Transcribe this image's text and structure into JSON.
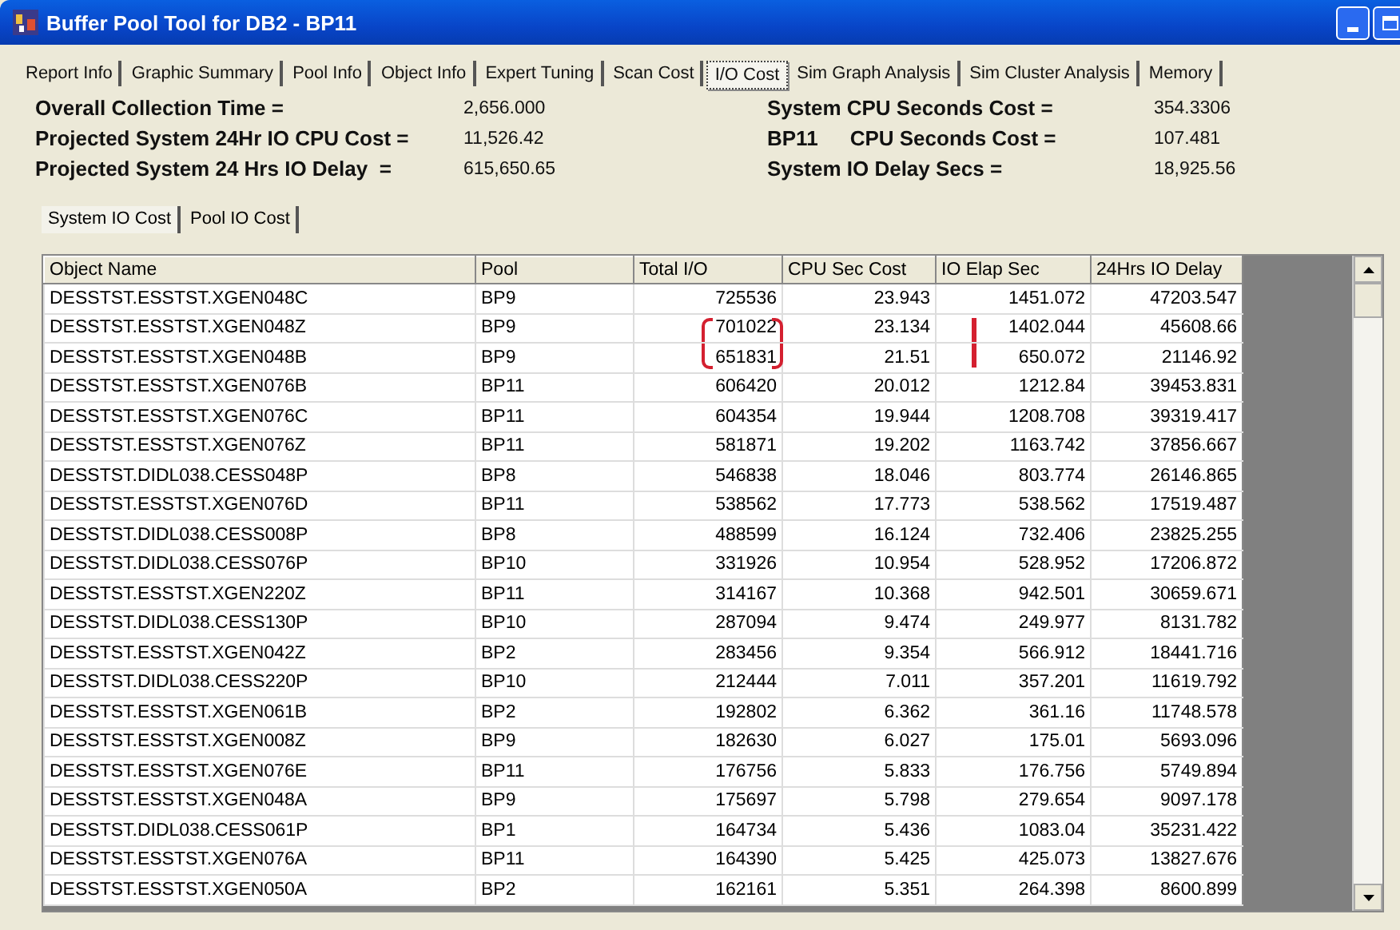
{
  "window": {
    "title": "Buffer Pool Tool for DB2 - BP11"
  },
  "tabs": [
    {
      "label": "Report Info",
      "selected": false
    },
    {
      "label": "Graphic Summary",
      "selected": false
    },
    {
      "label": "Pool Info",
      "selected": false
    },
    {
      "label": "Object Info",
      "selected": false
    },
    {
      "label": "Expert Tuning",
      "selected": false
    },
    {
      "label": "Scan Cost",
      "selected": false
    },
    {
      "label": "I/O Cost",
      "selected": true
    },
    {
      "label": "Sim Graph Analysis",
      "selected": false
    },
    {
      "label": "Sim Cluster Analysis",
      "selected": false
    },
    {
      "label": "Memory",
      "selected": false
    }
  ],
  "stats_left": [
    {
      "label": "Overall Collection Time =",
      "value": "2,656.000"
    },
    {
      "label": "Projected System 24Hr IO CPU Cost =",
      "value": "11,526.42"
    },
    {
      "label": "Projected System 24 Hrs IO Delay  =",
      "value": "615,650.65"
    }
  ],
  "stats_right": [
    {
      "label": "System CPU Seconds Cost =",
      "value": "354.3306"
    },
    {
      "prefix": "BP11",
      "label": "CPU Seconds Cost =",
      "value": "107.481"
    },
    {
      "label": "System IO Delay Secs =",
      "value": "18,925.56"
    }
  ],
  "sub_tabs": [
    {
      "label": "System IO Cost",
      "selected": true
    },
    {
      "label": "Pool IO Cost",
      "selected": false
    }
  ],
  "table": {
    "columns": [
      "Object Name",
      "Pool",
      "Total I/O",
      "CPU Sec Cost",
      "IO Elap Sec",
      "24Hrs IO Delay"
    ],
    "rows": [
      {
        "cells": [
          "DESSTST.ESSTST.XGEN048C",
          "BP9",
          "725536",
          "23.943",
          "1451.072",
          "47203.547"
        ],
        "marked": false
      },
      {
        "cells": [
          "DESSTST.ESSTST.XGEN048Z",
          "BP9",
          "701022",
          "23.134",
          "1402.044",
          "45608.66"
        ],
        "marked": true
      },
      {
        "cells": [
          "DESSTST.ESSTST.XGEN048B",
          "BP9",
          "651831",
          "21.51",
          "650.072",
          "21146.92"
        ],
        "marked": true
      },
      {
        "cells": [
          "DESSTST.ESSTST.XGEN076B",
          "BP11",
          "606420",
          "20.012",
          "1212.84",
          "39453.831"
        ],
        "marked": false
      },
      {
        "cells": [
          "DESSTST.ESSTST.XGEN076C",
          "BP11",
          "604354",
          "19.944",
          "1208.708",
          "39319.417"
        ],
        "marked": false
      },
      {
        "cells": [
          "DESSTST.ESSTST.XGEN076Z",
          "BP11",
          "581871",
          "19.202",
          "1163.742",
          "37856.667"
        ],
        "marked": false
      },
      {
        "cells": [
          "DESSTST.DIDL038.CESS048P",
          "BP8",
          "546838",
          "18.046",
          "803.774",
          "26146.865"
        ],
        "marked": false
      },
      {
        "cells": [
          "DESSTST.ESSTST.XGEN076D",
          "BP11",
          "538562",
          "17.773",
          "538.562",
          "17519.487"
        ],
        "marked": false
      },
      {
        "cells": [
          "DESSTST.DIDL038.CESS008P",
          "BP8",
          "488599",
          "16.124",
          "732.406",
          "23825.255"
        ],
        "marked": false
      },
      {
        "cells": [
          "DESSTST.DIDL038.CESS076P",
          "BP10",
          "331926",
          "10.954",
          "528.952",
          "17206.872"
        ],
        "marked": false
      },
      {
        "cells": [
          "DESSTST.ESSTST.XGEN220Z",
          "BP11",
          "314167",
          "10.368",
          "942.501",
          "30659.671"
        ],
        "marked": false
      },
      {
        "cells": [
          "DESSTST.DIDL038.CESS130P",
          "BP10",
          "287094",
          "9.474",
          "249.977",
          "8131.782"
        ],
        "marked": false
      },
      {
        "cells": [
          "DESSTST.ESSTST.XGEN042Z",
          "BP2",
          "283456",
          "9.354",
          "566.912",
          "18441.716"
        ],
        "marked": false
      },
      {
        "cells": [
          "DESSTST.DIDL038.CESS220P",
          "BP10",
          "212444",
          "7.011",
          "357.201",
          "11619.792"
        ],
        "marked": false
      },
      {
        "cells": [
          "DESSTST.ESSTST.XGEN061B",
          "BP2",
          "192802",
          "6.362",
          "361.16",
          "11748.578"
        ],
        "marked": false
      },
      {
        "cells": [
          "DESSTST.ESSTST.XGEN008Z",
          "BP9",
          "182630",
          "6.027",
          "175.01",
          "5693.096"
        ],
        "marked": false
      },
      {
        "cells": [
          "DESSTST.ESSTST.XGEN076E",
          "BP11",
          "176756",
          "5.833",
          "176.756",
          "5749.894"
        ],
        "marked": false
      },
      {
        "cells": [
          "DESSTST.ESSTST.XGEN048A",
          "BP9",
          "175697",
          "5.798",
          "279.654",
          "9097.178"
        ],
        "marked": false
      },
      {
        "cells": [
          "DESSTST.DIDL038.CESS061P",
          "BP1",
          "164734",
          "5.436",
          "1083.04",
          "35231.422"
        ],
        "marked": false
      },
      {
        "cells": [
          "DESSTST.ESSTST.XGEN076A",
          "BP11",
          "164390",
          "5.425",
          "425.073",
          "13827.676"
        ],
        "marked": false
      },
      {
        "cells": [
          "DESSTST.ESSTST.XGEN050A",
          "BP2",
          "162161",
          "5.351",
          "264.398",
          "8600.899"
        ],
        "marked": false
      }
    ]
  }
}
